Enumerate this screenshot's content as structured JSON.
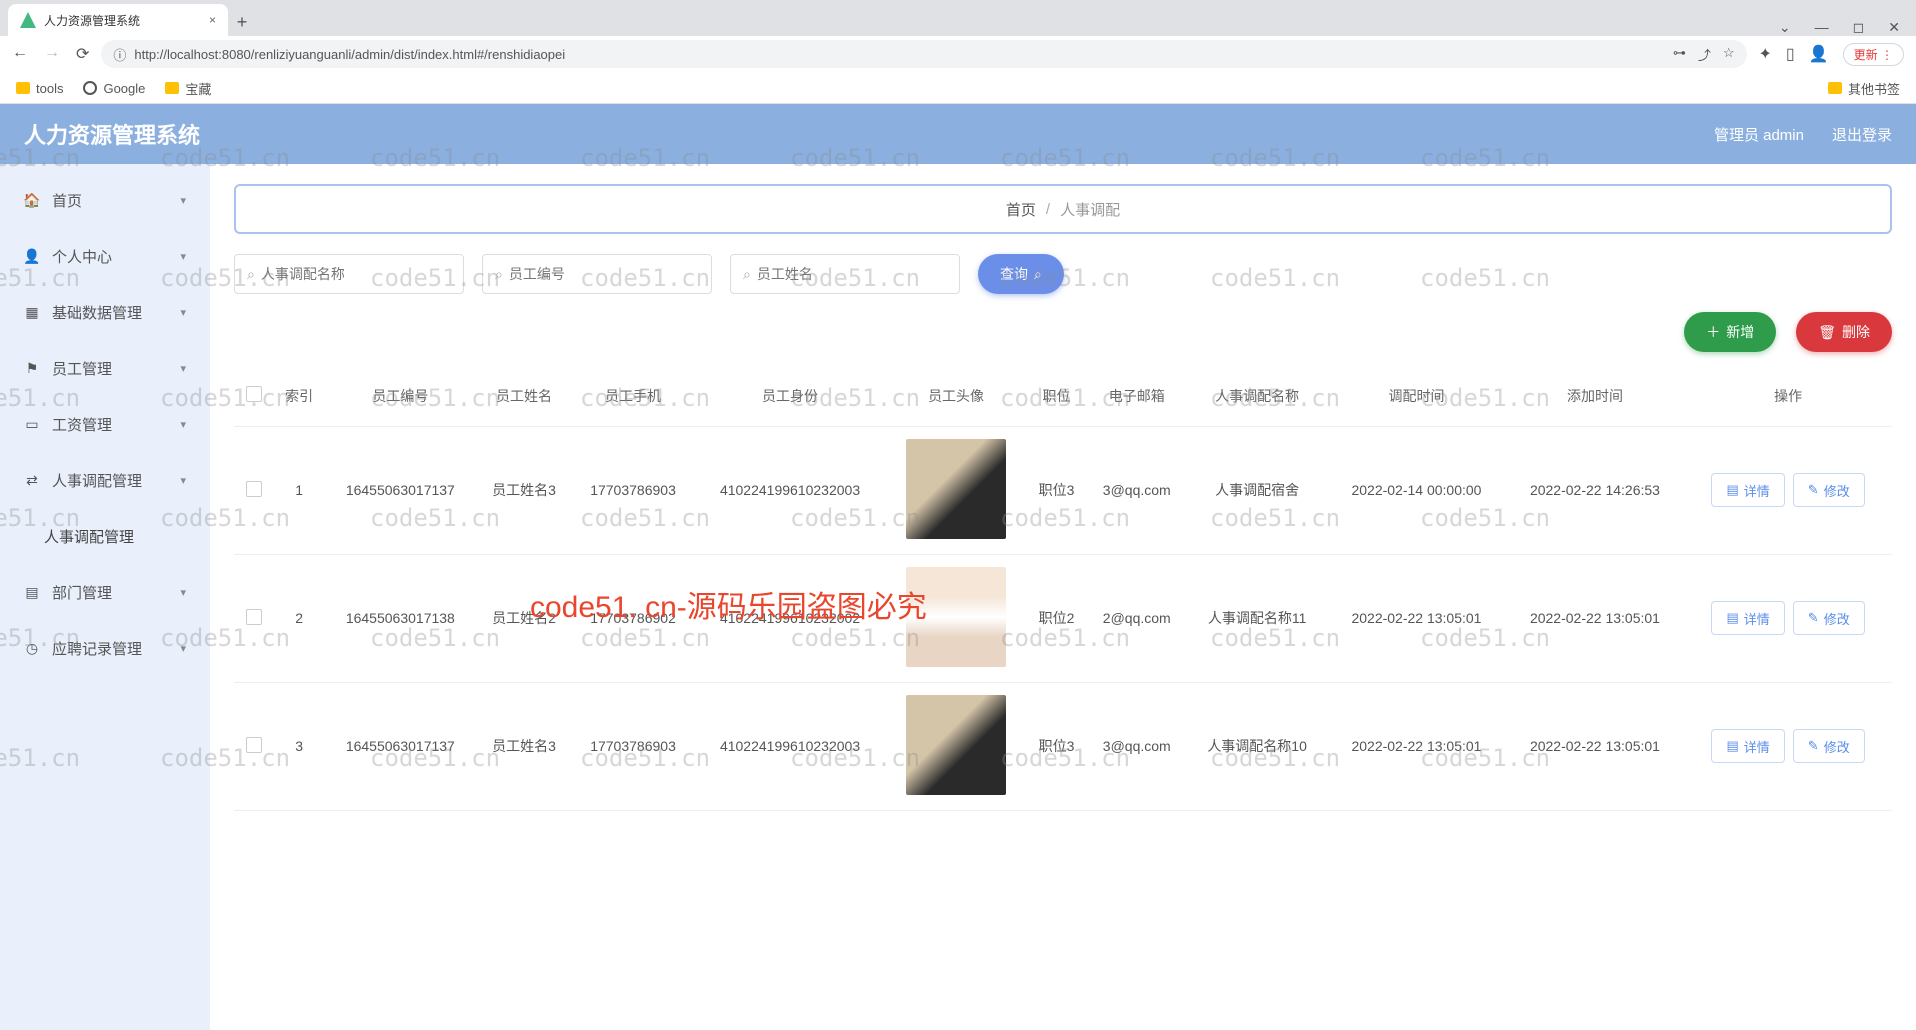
{
  "browser": {
    "tab_title": "人力资源管理系统",
    "url": "http://localhost:8080/renliziyuanguanli/admin/dist/index.html#/renshidiaopei",
    "update_btn": "更新",
    "bookmarks": {
      "tools": "tools",
      "google": "Google",
      "treasure": "宝藏",
      "other": "其他书签"
    }
  },
  "header": {
    "title": "人力资源管理系统",
    "user": "管理员 admin",
    "logout": "退出登录"
  },
  "sidebar": {
    "items": [
      {
        "icon": "🏠",
        "label": "首页"
      },
      {
        "icon": "👤",
        "label": "个人中心"
      },
      {
        "icon": "▦",
        "label": "基础数据管理"
      },
      {
        "icon": "⚑",
        "label": "员工管理"
      },
      {
        "icon": "▭",
        "label": "工资管理"
      },
      {
        "icon": "⇄",
        "label": "人事调配管理"
      },
      {
        "icon": "",
        "label": "人事调配管理",
        "sub": true
      },
      {
        "icon": "▤",
        "label": "部门管理"
      },
      {
        "icon": "◷",
        "label": "应聘记录管理"
      }
    ]
  },
  "breadcrumb": {
    "home": "首页",
    "current": "人事调配"
  },
  "search": {
    "ph1": "人事调配名称",
    "ph2": "员工编号",
    "ph3": "员工姓名",
    "query_btn": "查询"
  },
  "actions": {
    "add": "新增",
    "delete": "删除"
  },
  "table": {
    "headers": [
      "索引",
      "员工编号",
      "员工姓名",
      "员工手机",
      "员工身份",
      "员工头像",
      "职位",
      "电子邮箱",
      "人事调配名称",
      "调配时间",
      "添加时间",
      "操作"
    ],
    "rows": [
      {
        "idx": "1",
        "empno": "16455063017137",
        "name": "员工姓名3",
        "phone": "17703786903",
        "idcard": "410224199610232003",
        "pos": "职位3",
        "email": "3@qq.com",
        "tname": "人事调配宿舍",
        "ttime": "2022-02-14 00:00:00",
        "atime": "2022-02-22 14:26:53",
        "avatar": "m"
      },
      {
        "idx": "2",
        "empno": "16455063017138",
        "name": "员工姓名2",
        "phone": "17703786902",
        "idcard": "410224199610232002",
        "pos": "职位2",
        "email": "2@qq.com",
        "tname": "人事调配名称11",
        "ttime": "2022-02-22 13:05:01",
        "atime": "2022-02-22 13:05:01",
        "avatar": "f"
      },
      {
        "idx": "3",
        "empno": "16455063017137",
        "name": "员工姓名3",
        "phone": "17703786903",
        "idcard": "410224199610232003",
        "pos": "职位3",
        "email": "3@qq.com",
        "tname": "人事调配名称10",
        "ttime": "2022-02-22 13:05:01",
        "atime": "2022-02-22 13:05:01",
        "avatar": "m"
      }
    ],
    "op": {
      "detail": "详情",
      "edit": "修改"
    }
  },
  "watermark": {
    "text": "code51.cn",
    "big": "code51. cn-源码乐园盗图必究"
  }
}
